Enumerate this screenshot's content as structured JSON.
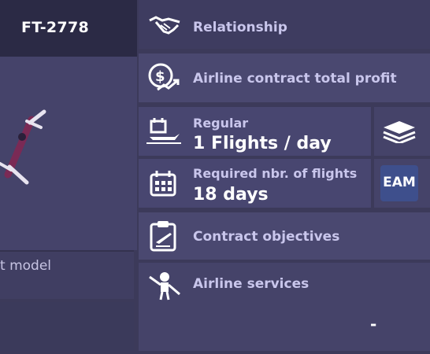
{
  "flight": {
    "code": "FT-2778"
  },
  "left": {
    "model_label": "t model"
  },
  "rows": {
    "relationship": {
      "label": "Relationship",
      "icon": "handshake-icon"
    },
    "profit": {
      "label": "Airline contract total profit",
      "icon": "money-growth-icon"
    },
    "regular": {
      "label": "Regular",
      "value": "1 Flights / day",
      "icon": "plane-calendar-icon"
    },
    "required": {
      "label": "Required nbr. of flights",
      "value": "18 days",
      "icon": "calendar-icon"
    },
    "objectives": {
      "label": "Contract objectives",
      "icon": "clipboard-plane-icon"
    },
    "services": {
      "label": "Airline services",
      "value": "-",
      "icon": "ground-crew-icon"
    }
  },
  "side": {
    "badge": "EAM",
    "icon": "layers-icon"
  },
  "colors": {
    "panel": "#4a4870",
    "dark": "#2b2a45",
    "label": "#c9c6ec",
    "badge": "#3e4f8c"
  }
}
